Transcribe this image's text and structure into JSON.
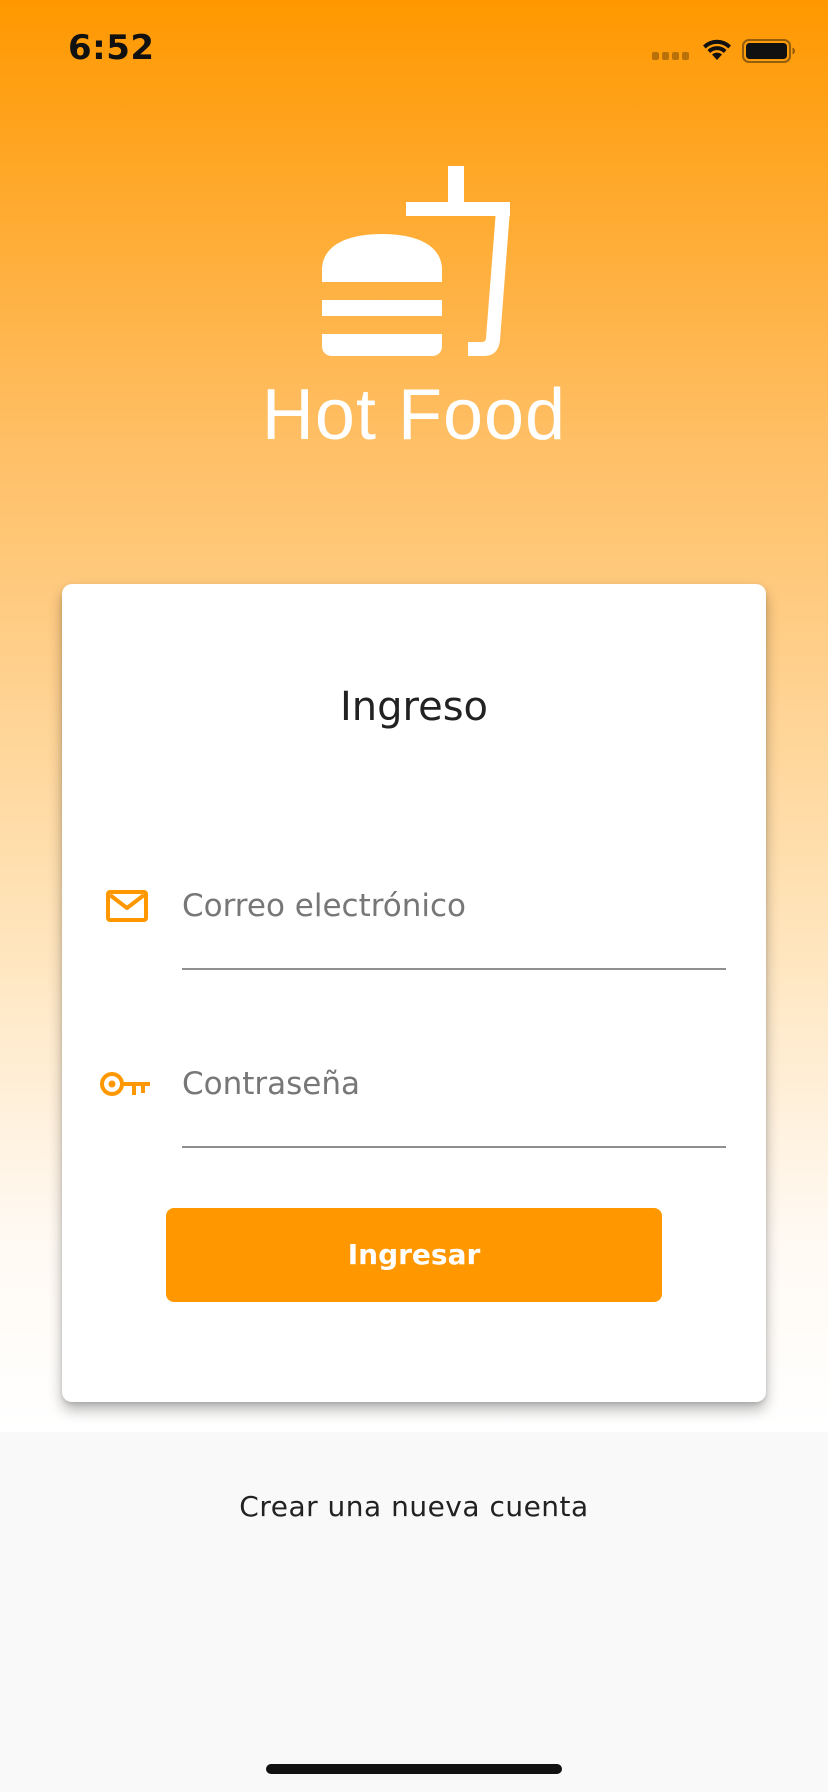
{
  "status_bar": {
    "time": "6:52"
  },
  "brand": {
    "app_name": "Hot Food",
    "logo_icon": "burger-drink-icon"
  },
  "login_card": {
    "title": "Ingreso",
    "email_field": {
      "placeholder": "Correo electrónico",
      "value": "",
      "icon": "mail-icon"
    },
    "password_field": {
      "placeholder": "Contraseña",
      "value": "",
      "icon": "key-icon"
    },
    "submit_label": "Ingresar"
  },
  "register_link": "Crear una nueva cuenta",
  "colors": {
    "accent": "#ff9800",
    "card_background": "#ffffff",
    "page_background": "#f9f9f9",
    "text_primary": "#222222"
  }
}
